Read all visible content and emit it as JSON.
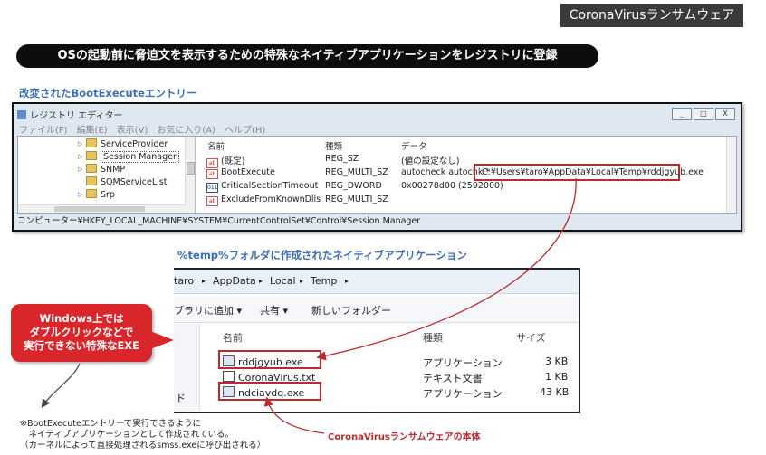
{
  "badge": "CoronaVirusランサムウェア",
  "headline": "OSの起動前に脅迫文を表示するための特殊なネイティブアプリケーションをレジストリに登録",
  "registry_section_label": "改変されたBootExecuteエントリー",
  "registry_editor": {
    "title": "レジストリ エディター",
    "window_buttons": [
      "_",
      "□",
      "X"
    ],
    "menu": [
      "ファイル(F)",
      "編集(E)",
      "表示(V)",
      "お気に入り(A)",
      "ヘルプ(H)"
    ],
    "tree_items": [
      "ServiceProvider",
      "Session Manager",
      "SNMP",
      "SQMServiceList",
      "Srp"
    ],
    "selected_tree_item": "Session Manager",
    "columns": [
      "名前",
      "種類",
      "データ"
    ],
    "values": [
      {
        "name": "(既定)",
        "type": "REG_SZ",
        "data": "(値の設定なし)",
        "icon": "string-value-icon"
      },
      {
        "name": "BootExecute",
        "type": "REG_MULTI_SZ",
        "data": "autocheck autochk *",
        "data_highlight": "C:¥Users¥taro¥AppData¥Local¥Temp¥rddjgyub.exe",
        "icon": "string-value-icon"
      },
      {
        "name": "CriticalSectionTimeout",
        "type": "REG_DWORD",
        "data": "0x00278d00 (2592000)",
        "icon": "binary-value-icon"
      },
      {
        "name": "ExcludeFromKnownDlls",
        "type": "REG_MULTI_SZ",
        "data": "",
        "icon": "string-value-icon"
      }
    ],
    "status_path": "コンピューター¥HKEY_LOCAL_MACHINE¥SYSTEM¥CurrentControlSet¥Control¥Session Manager"
  },
  "explorer_section_label": "%temp%フォルダに作成されたネイティブアプリケーション",
  "explorer": {
    "breadcrumb": [
      "taro",
      "AppData",
      "Local",
      "Temp"
    ],
    "toolbar": {
      "library_button": "ブラリに追加 ▾",
      "share_button": "共有 ▾",
      "new_folder_button": "新しいフォルダー"
    },
    "columns": [
      "名前",
      "種類",
      "サイズ"
    ],
    "files": [
      {
        "name": "rddjgyub.exe",
        "type": "アプリケーション",
        "size": "3 KB",
        "icon": "exe-file-icon"
      },
      {
        "name": "CoronaVirus.txt",
        "type": "テキスト文書",
        "size": "1 KB",
        "icon": "text-file-icon"
      },
      {
        "name": "ndciavdq.exe",
        "type": "アプリケーション",
        "size": "43 KB",
        "icon": "exe-file-icon"
      }
    ],
    "left_pane_char": "ド"
  },
  "callout": {
    "line1": "Windows上では",
    "line2": "ダブルクリックなどで",
    "line3": "実行できない特殊なEXE"
  },
  "notes": [
    "※BootExecuteエントリーで実行できるように",
    "　ネイティブアプリケーションとして作成されている。",
    "（カーネルによって直接処理されるsmss.exeに呼び出される）"
  ],
  "ransomware_body_label": "CoronaVirusランサムウェアの本体",
  "colors": {
    "accent_red": "#c0282a",
    "label_blue": "#3b6fb8",
    "headline_bg": "#0d0d0d"
  }
}
